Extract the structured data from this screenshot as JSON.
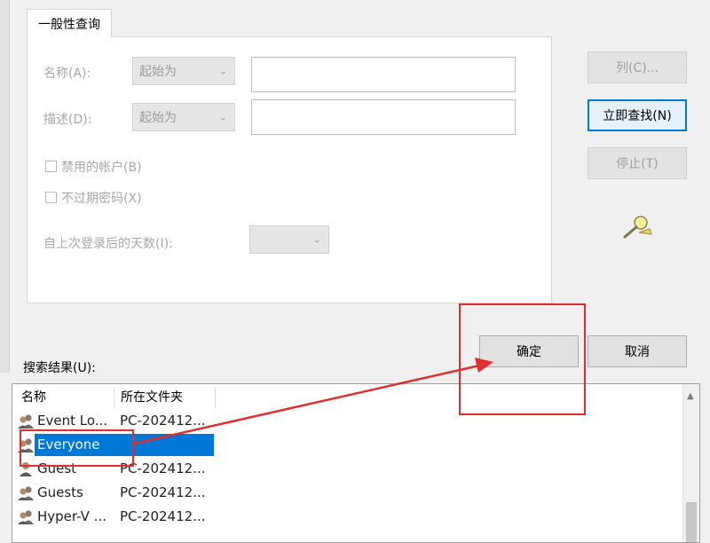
{
  "tab": {
    "label": "一般性查询"
  },
  "query": {
    "name_label": "名称(A):",
    "name_mode": "起始为",
    "name_value": "",
    "desc_label": "描述(D):",
    "desc_mode": "起始为",
    "desc_value": "",
    "disabled_accounts_label": "禁用的帐户(B)",
    "disabled_accounts_checked": false,
    "non_expiring_pw_label": "不过期密码(X)",
    "non_expiring_pw_checked": false,
    "days_since_logon_label": "自上次登录后的天数(I):",
    "days_since_logon_value": ""
  },
  "buttons": {
    "columns": "列(C)...",
    "find_now": "立即查找(N)",
    "stop": "停止(T)",
    "ok": "确定",
    "cancel": "取消"
  },
  "icons": {
    "search": "search-magnifier-icon",
    "group": "user-group-icon"
  },
  "results": {
    "label": "搜索结果(U):",
    "columns": [
      "名称",
      "所在文件夹"
    ],
    "rows": [
      {
        "name": "Event Lo...",
        "folder": "PC-202412..."
      },
      {
        "name": "Everyone",
        "folder": ""
      },
      {
        "name": "Guest",
        "folder": "PC-202412..."
      },
      {
        "name": "Guests",
        "folder": "PC-202412..."
      },
      {
        "name": "Hyper-V ...",
        "folder": "PC-202412..."
      }
    ],
    "selected_index": 1
  },
  "colors": {
    "accent": "#0078d7",
    "annotation": "#e02d2d"
  }
}
